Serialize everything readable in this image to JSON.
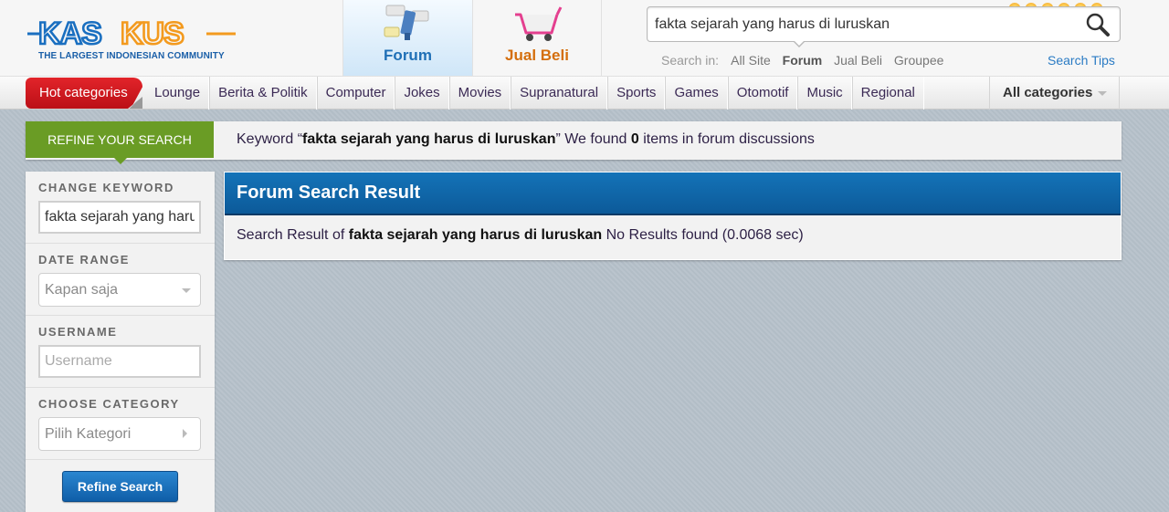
{
  "header": {
    "logo_text": "KASKUS",
    "logo_tagline": "THE LARGEST INDONESIAN COMMUNITY",
    "nav_tabs": [
      {
        "label": "Forum",
        "icon": "forum-icon",
        "active": true
      },
      {
        "label": "Jual Beli",
        "icon": "shopping-cart-icon",
        "active": false
      }
    ],
    "search": {
      "value": "fakta sejarah yang harus di luruskan",
      "search_in_label": "Search in:",
      "options": [
        "All Site",
        "Forum",
        "Jual Beli",
        "Groupee"
      ],
      "active_option": "Forum",
      "tips_label": "Search Tips"
    }
  },
  "categories": {
    "hot_label": "Hot categories",
    "items": [
      "Lounge",
      "Berita & Politik",
      "Computer",
      "Jokes",
      "Movies",
      "Supranatural",
      "Sports",
      "Games",
      "Otomotif",
      "Music",
      "Regional"
    ],
    "all_label": "All categories"
  },
  "refine_bar": {
    "tag": "Refine your search",
    "prefix": "Keyword “",
    "keyword": "fakta sejarah yang harus di luruskan",
    "middle": "” We found ",
    "count": "0",
    "suffix": " items in forum discussions"
  },
  "sidebar": {
    "keyword_label": "Change Keyword",
    "keyword_value": "fakta sejarah yang harus di luruskan",
    "date_label": "Date Range",
    "date_value": "Kapan saja",
    "username_label": "Username",
    "username_placeholder": "Username",
    "category_label": "Choose Category",
    "category_value": "Pilih Kategori",
    "button_label": "Refine Search"
  },
  "result": {
    "title": "Forum Search Result",
    "prefix": "Search Result of ",
    "keyword": "fakta sejarah yang harus di luruskan",
    "status": " No Results found (0.0068 sec)"
  },
  "colors": {
    "brand_blue": "#1a5fa8",
    "brand_orange": "#f39a1e",
    "hot_red": "#d41a20",
    "refine_green": "#6a9c25",
    "result_header_blue": "#1473b8"
  }
}
